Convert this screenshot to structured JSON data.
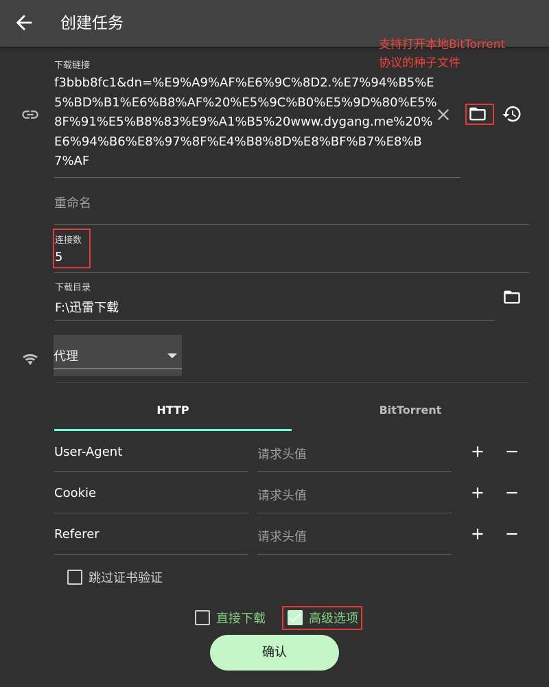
{
  "appbar": {
    "title": "创建任务",
    "back_icon": "arrow-left-icon"
  },
  "annotation": {
    "text": "支持打开本地BitTorrent\n协议的种子文件",
    "color": "#f44336"
  },
  "link_field": {
    "label": "下载链接",
    "value": "f3bbb8fc1&dn=%E9%A9%AF%E6%9C%8D2.%E7%94%B5%E5%BD%B1%E6%B8%AF%20%E5%9C%B0%E5%9D%80%E5%8F%91%E5%B8%83%E9%A1%B5%20www.dygang.me%20%E6%94%B6%E8%97%8F%E4%B8%8D%E8%BF%B7%E8%B7%AF",
    "icons": [
      "link-icon",
      "close-icon",
      "folder-icon",
      "history-icon"
    ]
  },
  "rename_field": {
    "placeholder": "重命名"
  },
  "connections_field": {
    "label": "连接数",
    "value": "5"
  },
  "directory_field": {
    "label": "下载目录",
    "value": "F:\\迅雷下载"
  },
  "proxy": {
    "label": "代理",
    "icon": "wifi-icon"
  },
  "tabs": [
    {
      "label": "HTTP",
      "active": true
    },
    {
      "label": "BitTorrent",
      "active": false
    }
  ],
  "headers": [
    {
      "name": "User-Agent",
      "value_placeholder": "请求头值"
    },
    {
      "name": "Cookie",
      "value_placeholder": "请求头值"
    },
    {
      "name": "Referer",
      "value_placeholder": "请求头值"
    }
  ],
  "skip_cert": {
    "label": "跳过证书验证",
    "checked": false
  },
  "direct_download": {
    "label": "直接下载",
    "checked": false
  },
  "advanced_options": {
    "label": "高级选项",
    "checked": true
  },
  "confirm": {
    "label": "确认"
  },
  "colors": {
    "background": "#303030",
    "appbar": "#424242",
    "accent_tab": "#64ffda",
    "green_label": "#7ed07f",
    "confirm_button": "#c4f5c6",
    "highlight_box": "#e53935"
  }
}
